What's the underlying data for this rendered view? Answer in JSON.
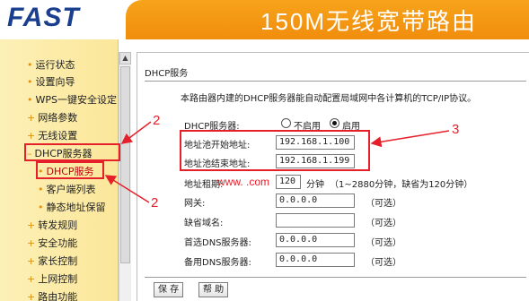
{
  "header": {
    "logo": "FAST",
    "banner_title": "150M无线宽带路由"
  },
  "sidebar": {
    "items": [
      {
        "label": "运行状态"
      },
      {
        "label": "设置向导"
      },
      {
        "label": "WPS一键安全设定"
      },
      {
        "label": "网络参数"
      },
      {
        "label": "无线设置"
      },
      {
        "label": "DHCP服务器"
      },
      {
        "label": "DHCP服务"
      },
      {
        "label": "客户端列表"
      },
      {
        "label": "静态地址保留"
      },
      {
        "label": "转发规则"
      },
      {
        "label": "安全功能"
      },
      {
        "label": "家长控制"
      },
      {
        "label": "上网控制"
      },
      {
        "label": "路由功能"
      }
    ],
    "bullets": {
      "expanded": "–",
      "collapsed": "+",
      "item": "•"
    }
  },
  "main": {
    "title": "DHCP服务",
    "description": "本路由器内建的DHCP服务器能自动配置局域网中各计算机的TCP/IP协议。",
    "dhcp_server": {
      "label": "DHCP服务器:",
      "off_label": "不启用",
      "on_label": "启用",
      "selected": "启用"
    },
    "pool_start": {
      "label": "地址池开始地址:",
      "value": "192.168.1.100"
    },
    "pool_end": {
      "label": "地址池结束地址:",
      "value": "192.168.1.199"
    },
    "lease": {
      "label": "地址租期:",
      "value": "120",
      "unit": "分钟",
      "hint": "（1~2880分钟，缺省为120分钟）"
    },
    "gateway": {
      "label": "网关:",
      "value": "0.0.0.0",
      "hint": "（可选）"
    },
    "domain": {
      "label": "缺省域名:",
      "value": "",
      "hint": "（可选）"
    },
    "dns1": {
      "label": "首选DNS服务器:",
      "value": "0.0.0.0",
      "hint": "（可选）"
    },
    "dns2": {
      "label": "备用DNS服务器:",
      "value": "0.0.0.0",
      "hint": "（可选）"
    },
    "save_label": "保 存",
    "help_label": "帮 助"
  },
  "annotations": {
    "num_2a": "2",
    "num_2b": "2",
    "num_3": "3",
    "watermark": "www.        .com"
  },
  "colors": {
    "accent_orange": "#f18d0d",
    "logo_blue": "#1a3f8f",
    "annotation_red": "#e6202b",
    "sidebar_bg": "#fbe79a"
  }
}
